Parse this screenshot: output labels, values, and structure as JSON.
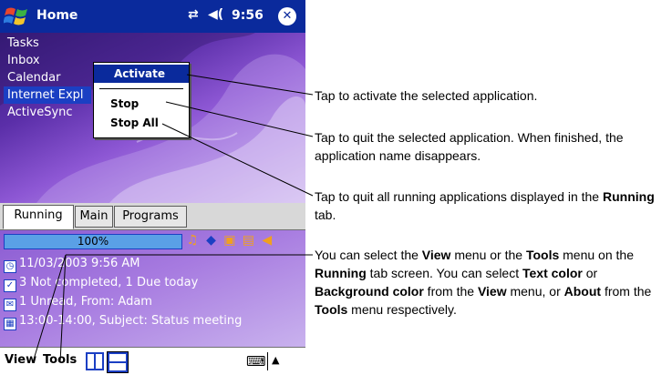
{
  "titlebar": {
    "title": "Home",
    "clock": "9:56",
    "connectivity_icon": "⇄",
    "volume_icon": "◀(",
    "close_icon": "✕"
  },
  "running_apps": [
    "Tasks",
    "Inbox",
    "Calendar",
    "Internet Expl",
    "ActiveSync"
  ],
  "selected_app_index": 3,
  "context_menu": {
    "activate": "Activate",
    "stop": "Stop",
    "stop_all": "Stop All"
  },
  "tabs": {
    "running": "Running",
    "main": "Main",
    "programs": "Programs"
  },
  "today": {
    "battery_text": "100%",
    "battery_level": 1.0,
    "date": "11/03/2003 9:56 AM",
    "tasks": "3 Not completed, 1 Due today",
    "inbox": "1 Unread, From: Adam",
    "calendar": "13:00-14:00, Subject: Status meeting",
    "status_icons": [
      "♫",
      "◆",
      "▣",
      "▤",
      "◀"
    ]
  },
  "menubar": {
    "view": "View",
    "tools": "Tools",
    "keyboard_icon": "⌨",
    "sip_arrow": "▲"
  },
  "callouts": {
    "activate": "Tap to activate the selected application.",
    "stop": "Tap to quit the selected application. When finished, the application name disappears.",
    "stopall_prefix": "Tap to quit all running applications displayed in the ",
    "stopall_bold": "Running",
    "stopall_suffix": " tab.",
    "view": {
      "t1": "You can select the ",
      "b1": "View",
      "t2": " menu or the ",
      "b2": "Tools",
      "t3": " menu on the ",
      "b3": "Running",
      "t4": " tab screen. You can select ",
      "b4": "Text color",
      "t5": " or ",
      "b5": "Background color",
      "t6": " from the ",
      "b6": "View",
      "t7": " menu, or ",
      "b7": "About",
      "t8": " from the ",
      "b8": "Tools",
      "t9": " menu respectively."
    }
  },
  "colors": {
    "titlebar": "#0a2a9c",
    "selection": "#1b3fc3",
    "wallpaper_dark": "#3a1d7e",
    "wallpaper_light": "#d9c8f3"
  }
}
